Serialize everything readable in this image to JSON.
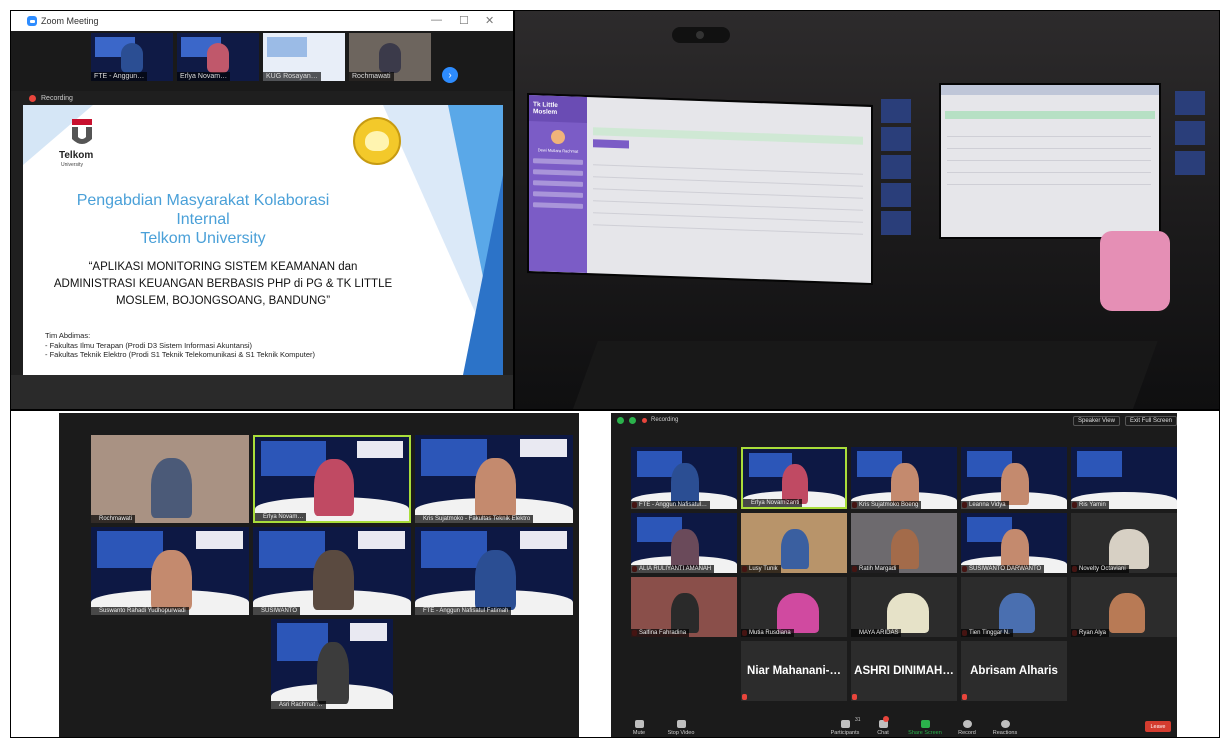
{
  "panel1": {
    "window_title": "Zoom Meeting",
    "thumbnails": [
      {
        "name": "FTE - Anggun…"
      },
      {
        "name": "Erlya Novam…"
      },
      {
        "name": "KUG Rosayan…"
      },
      {
        "name": "Rochmawati"
      }
    ],
    "recording_label": "Recording",
    "slide": {
      "logo_name": "Telkom",
      "logo_sub": "University",
      "title_line1": "Pengabdian Masyarakat Kolaborasi Internal",
      "title_line2": "Telkom University",
      "quote_line1": "“APLIKASI MONITORING SISTEM KEAMANAN dan",
      "quote_line2": "ADMINISTRASI KEUANGAN BERBASIS PHP di PG & TK LITTLE",
      "quote_line3": "MOSLEM, BOJONGSOANG, BANDUNG”",
      "team_heading": "Tim Abdimas:",
      "team_line1": "- Fakultas Ilmu Terapan   (Prodi D3 Sistem Informasi Akuntansi)",
      "team_line2": "- Fakultas Teknik Elektro (Prodi S1 Teknik Telekomunikasi & S1 Teknik Komputer)"
    }
  },
  "panel2": {
    "app_brand": "Tk Little Moslem",
    "app_user": "Dewi Mutiara Rachmat"
  },
  "panel3_left": {
    "tiles": [
      {
        "name": "Rochmawati"
      },
      {
        "name": "Erlya Novam…"
      },
      {
        "name": "Kris Sujatmoko - Fakultas Teknik Elektro"
      },
      {
        "name": "Suswanto Rahadi Yudhopurwadi"
      },
      {
        "name": "SUSIWANTO"
      },
      {
        "name": "FTE - Anggun Nafisatul Fatimah"
      },
      {
        "name": "Asri Rachmat …"
      }
    ]
  },
  "panel3_right": {
    "recording_label": "Recording",
    "speaker_view": "Speaker View",
    "exit_full": "Exit Full Screen",
    "tiles": [
      {
        "name": "FTE - Anggun Nafisatul…"
      },
      {
        "name": "Erlya Novamizanti"
      },
      {
        "name": "Kris Sujatmoko Boeng"
      },
      {
        "name": "Leanna Vidya"
      },
      {
        "name": "Ris Yamin"
      },
      {
        "name": "ALIA RULIYANTI AMANAH"
      },
      {
        "name": "Lusy Tunik"
      },
      {
        "name": "Ratih Margadi"
      },
      {
        "name": "SUSIWANTO DARWANTO"
      },
      {
        "name": "Novelty Octaviani"
      },
      {
        "name": "Salfina Fahradina"
      },
      {
        "name": "Mutia Rusdiana"
      },
      {
        "name": "MAYA ARIDAS"
      },
      {
        "name": "Tien Tinggar N."
      },
      {
        "name": "Ryan Alya"
      }
    ],
    "name_tiles": [
      {
        "name": "Niar Mahanani-…"
      },
      {
        "name": "ASHRI DINIMAH…"
      },
      {
        "name": "Abrisam Alharis"
      }
    ],
    "toolbar": {
      "mute": "Mute",
      "stop_video": "Stop Video",
      "participants": "Participants",
      "participants_count": "31",
      "chat": "Chat",
      "share": "Share Screen",
      "record": "Record",
      "reactions": "Reactions",
      "leave": "Leave"
    }
  }
}
